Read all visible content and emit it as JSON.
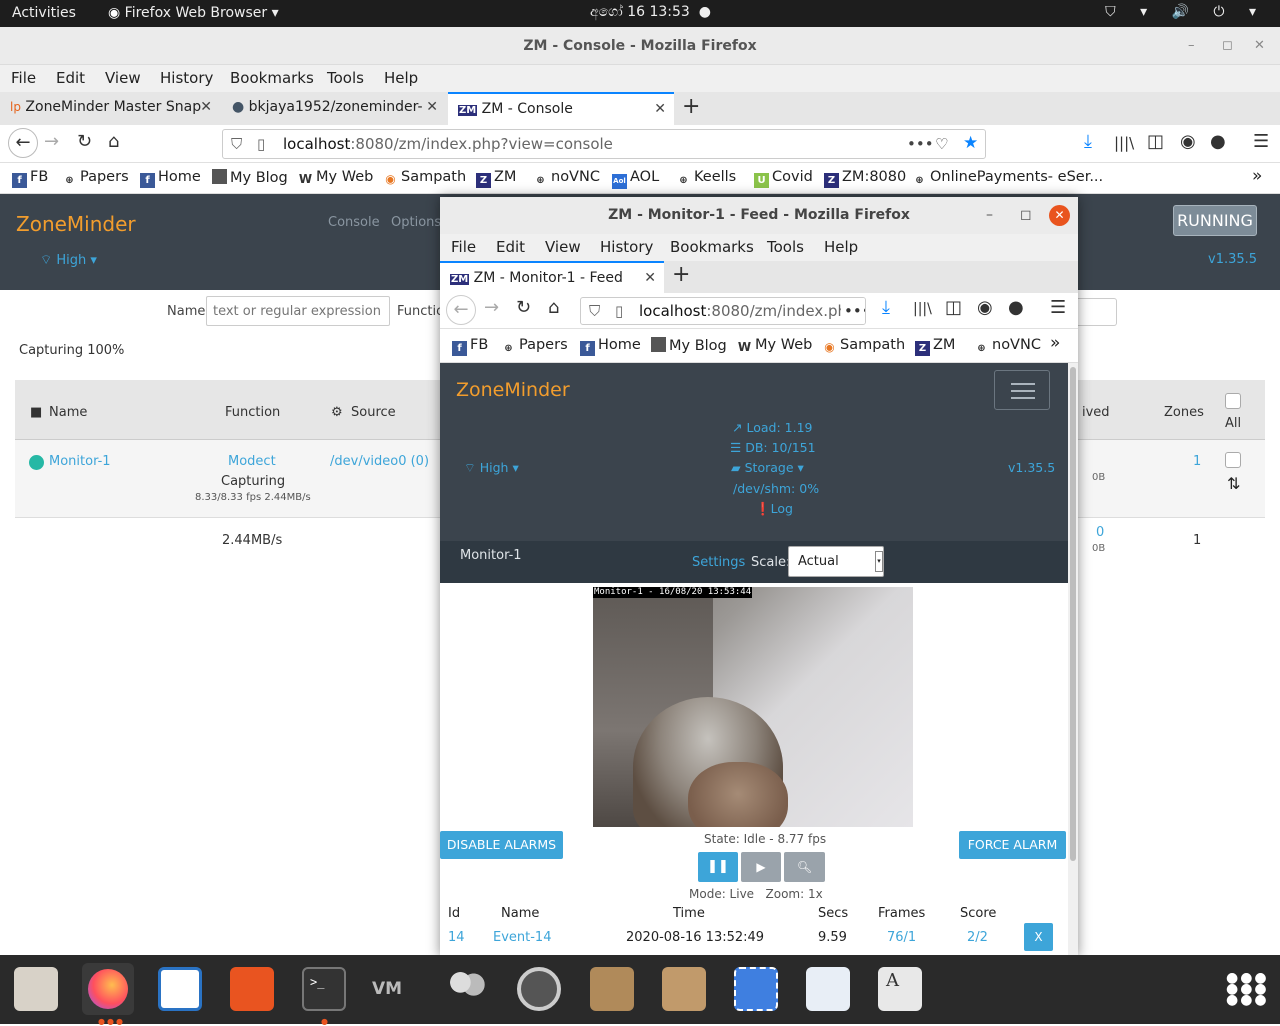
{
  "topbar": {
    "activities": "Activities",
    "app": "Firefox Web Browser ▾",
    "clock": "අගෝ 16  13:53",
    "dot": "●",
    "tray": "⛉ ▾ 🔊 ⏻ ▾"
  },
  "window": {
    "title": "ZM - Console - Mozilla Firefox",
    "min": "–",
    "max": "◻",
    "close": "✕"
  },
  "menu": [
    "File",
    "Edit",
    "View",
    "History",
    "Bookmarks",
    "Tools",
    "Help"
  ],
  "tabs": [
    {
      "label": "ZoneMinder Master Snap",
      "icon": "lp"
    },
    {
      "label": "bkjaya1952/zoneminder-",
      "icon": "●"
    },
    {
      "label": "ZM - Console",
      "icon": "ZM"
    }
  ],
  "newtab": "+",
  "url": {
    "host": "localhost",
    "rest": ":8080/zm/index.php?view=console",
    "dots": "•••"
  },
  "bookmarks": [
    "FB",
    "Papers",
    "Home",
    "My Blog",
    "My Web",
    "Sampath",
    "ZM",
    "noVNC",
    "AOL",
    "Keells",
    "Covid",
    "ZM:8080",
    "OnlinePayments- eSer..."
  ],
  "zm": {
    "brand": "ZoneMinder",
    "nav": [
      "Console",
      "Options"
    ],
    "high": "High ▾",
    "running": "RUNNING",
    "version": "v1.35.5",
    "filter_name_label": "Name",
    "filter_name_placeholder": "text or regular expression",
    "filter_function_label": "Functio",
    "capturing": "Capturing 100%",
    "headers": {
      "name": "Name",
      "function": "Function",
      "source": "Source",
      "received": "ived",
      "zones": "Zones",
      "all": "All"
    },
    "monitor": {
      "name": "Monitor-1",
      "function": "Modect",
      "status": "Capturing",
      "fps": "8.33/8.33 fps 2.44MB/s",
      "source": "/dev/video0 (0)",
      "recv": "0B",
      "zones": "1"
    },
    "totals": {
      "bandwidth": "2.44MB/s",
      "events": "0",
      "size": "0B",
      "zones": "1"
    }
  },
  "popup": {
    "title": "ZM - Monitor-1 - Feed - Mozilla Firefox",
    "tab": "ZM - Monitor-1 - Feed",
    "url_host": "localhost",
    "url_rest": ":8080/zm/index.ph",
    "bookmarks": [
      "FB",
      "Papers",
      "Home",
      "My Blog",
      "My Web",
      "Sampath",
      "ZM",
      "noVNC"
    ],
    "brand": "ZoneMinder",
    "load": "Load: 1.19",
    "db": "DB: 10/151",
    "storage": "Storage ▾",
    "shm": "/dev/shm: 0%",
    "log": "Log",
    "high": "High ▾",
    "version": "v1.35.5",
    "monitor_name": "Monitor-1",
    "settings": "Settings",
    "scale_label": "Scale:",
    "scale_value": "Actual",
    "timestamp": "Monitor-1 - 16/08/20 13:53:44",
    "state": "State: Idle - 8.77 fps",
    "disable_alarms": "DISABLE ALARMS",
    "force_alarm": "FORCE ALARM",
    "mode": "Mode: Live   Zoom: 1x",
    "events_headers": [
      "Id",
      "Name",
      "Time",
      "Secs",
      "Frames",
      "Score"
    ],
    "event": {
      "id": "14",
      "name": "Event-14",
      "time": "2020-08-16 13:52:49",
      "secs": "9.59",
      "frames": "76/1",
      "score": "2/2",
      "delete": "X"
    }
  }
}
